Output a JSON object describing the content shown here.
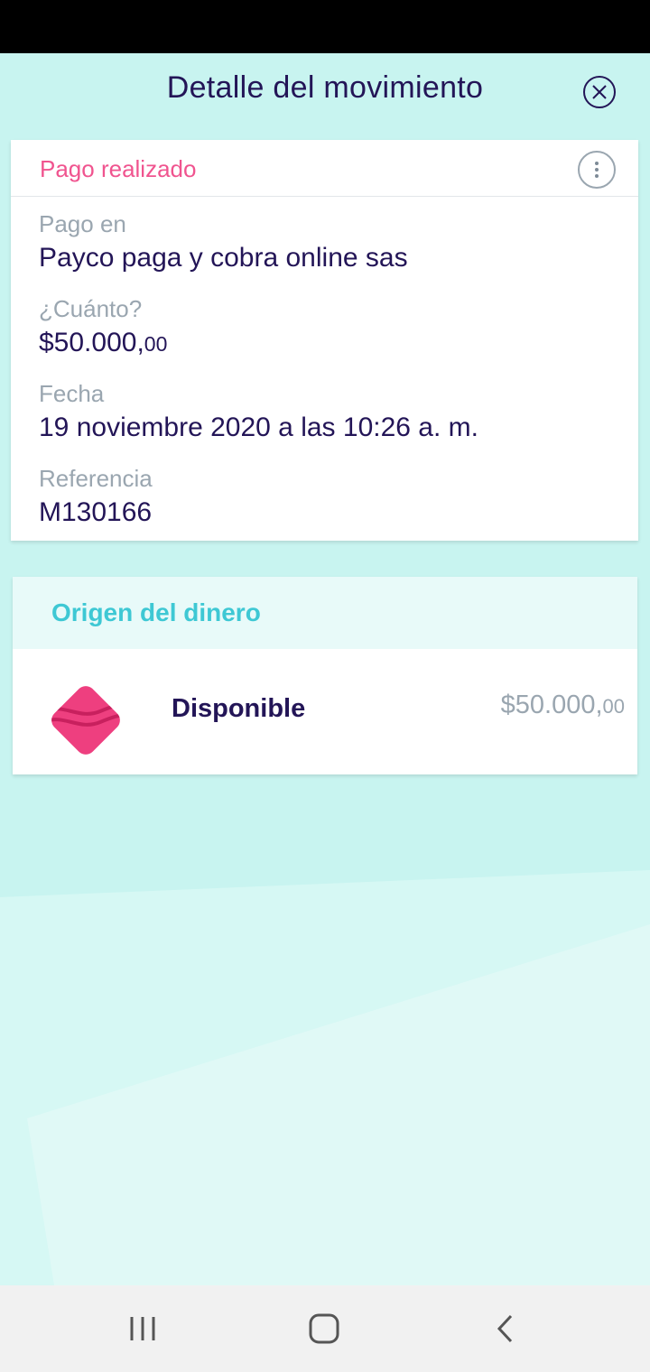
{
  "header": {
    "title": "Detalle del movimiento"
  },
  "movement": {
    "status": "Pago realizado",
    "fields": [
      {
        "label": "Pago en",
        "value": "Payco paga y cobra online sas"
      },
      {
        "label": "¿Cuánto?",
        "value": "$50.000,",
        "cents": "00"
      },
      {
        "label": "Fecha",
        "value": "19 noviembre 2020 a las 10:26 a. m."
      },
      {
        "label": "Referencia",
        "value": "M130166"
      }
    ]
  },
  "origin": {
    "title": "Origen del dinero",
    "source": {
      "name": "Disponible",
      "amount": "$50.000,",
      "cents": "00",
      "icon": "pocket-diamond-icon"
    }
  },
  "nav": {
    "icons": [
      "recent-apps-icon",
      "home-icon",
      "back-icon"
    ]
  },
  "colors": {
    "background": "#c8f4f0",
    "brand_dark": "#231557",
    "accent_pink": "#f0548f",
    "accent_teal": "#3ec8d4",
    "muted": "#9aa6b0"
  }
}
